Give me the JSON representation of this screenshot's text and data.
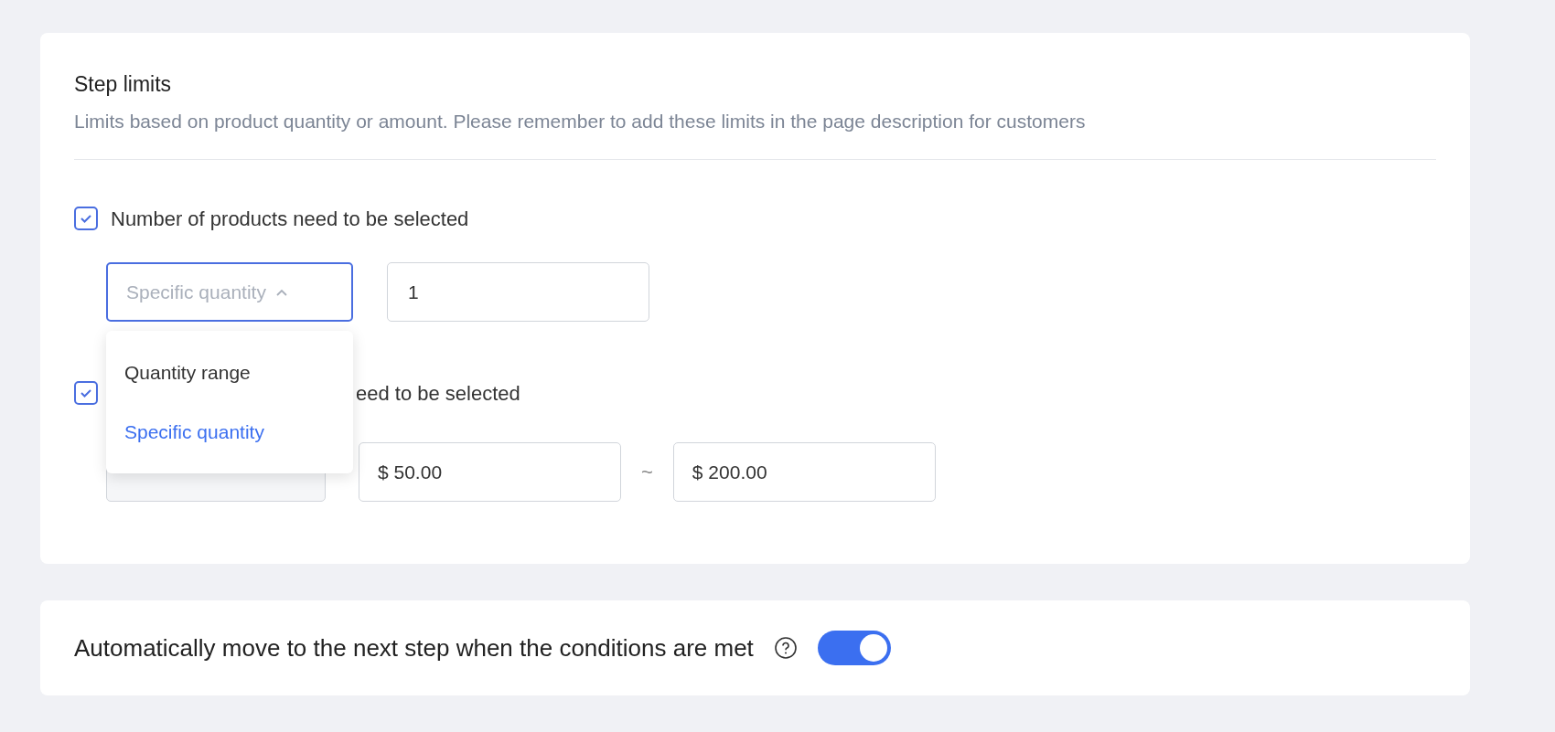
{
  "step_limits": {
    "title": "Step limits",
    "description": "Limits based on product quantity or amount. Please remember to add these limits in the page description for customers",
    "quantity": {
      "checked": true,
      "label": "Number of products need to be selected",
      "select": {
        "value": "Specific quantity",
        "expanded": true
      },
      "value": "1",
      "options": [
        {
          "label": "Quantity range",
          "selected": false
        },
        {
          "label": "Specific quantity",
          "selected": true
        }
      ]
    },
    "amount": {
      "checked": true,
      "label": "eed to be selected",
      "min": "$ 50.00",
      "separator": "~",
      "max": "$ 200.00"
    }
  },
  "auto_advance": {
    "label": "Automatically move to the next step when the conditions are met",
    "on": true
  }
}
